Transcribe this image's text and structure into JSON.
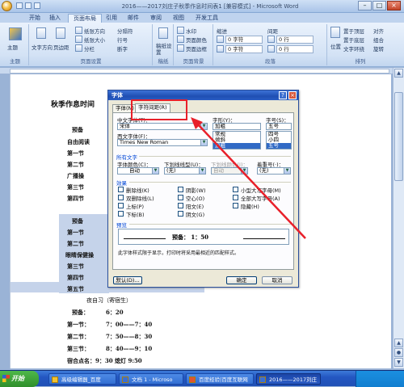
{
  "window": {
    "title": "2016——2017刘庄子秋季作息时间表1 [兼容模式] - Microsoft Word"
  },
  "ribbon_tabs": [
    {
      "label": "开始"
    },
    {
      "label": "插入"
    },
    {
      "label": "页面布局"
    },
    {
      "label": "引用"
    },
    {
      "label": "邮件"
    },
    {
      "label": "审阅"
    },
    {
      "label": "视图"
    },
    {
      "label": "开发工具"
    }
  ],
  "ribbon": {
    "groups": {
      "theme": "主题",
      "page_setup": "页面设置",
      "draft": "稿纸",
      "page_bg": "页面背景",
      "paragraph": "段落",
      "arrange": "排列"
    },
    "items": {
      "theme": "主题",
      "text_direction": "文字方向",
      "margins": "页边距",
      "size": "纸张大小",
      "orientation": "纸张方向",
      "columns": "分栏",
      "breaks": "分隔符",
      "line_numbers": "行号",
      "hyphenation": "断字",
      "draft_settings": "稿纸设置",
      "watermark": "水印",
      "page_color": "页面颜色",
      "page_border": "页面边框",
      "indent": "缩进",
      "spacing": "间距",
      "indent_left": "0 字符",
      "indent_right": "0 字符",
      "space_before": "0 行",
      "space_after": "0 行",
      "position": "位置",
      "bring_front": "置于顶层",
      "send_back": "置于底层",
      "text_wrap": "文字环绕",
      "align": "对齐",
      "group": "组合",
      "rotate": "旋转"
    }
  },
  "document": {
    "title": "秋季作息时间",
    "labels_top": [
      "预备",
      "自由阅读",
      "第一节",
      "第二节",
      "广播操",
      "第三节",
      "第四节"
    ],
    "labels_selected": [
      "预备",
      "第一节",
      "第二节",
      "眼睛保健操",
      "第三节",
      "第四节",
      "第五节"
    ],
    "subtitle": "夜自习（寄宿生）",
    "bottom_rows": [
      {
        "label": "预备：",
        "time": "6：20"
      },
      {
        "label": "第一节：",
        "time": "7：00——7：40"
      },
      {
        "label": "第二节：",
        "time": "7：50——8：30"
      },
      {
        "label": "第三节：",
        "time": "8：40——9：10"
      }
    ],
    "last_row": "宿合点名：9：30    熄灯 9:50"
  },
  "font_dialog": {
    "title": "字体",
    "tabs": [
      {
        "label": "字体(N)"
      },
      {
        "label": "字符间距(R)"
      }
    ],
    "chinese_font_label": "中文字体(T)：",
    "chinese_font_value": "宋体",
    "western_font_label": "西文字体(F)：",
    "western_font_value": "Times New Roman",
    "style_label": "字形(Y)：",
    "style_value": "加粗",
    "style_options": [
      "常规",
      "倾斜",
      "加粗"
    ],
    "size_label": "字号(S)：",
    "size_value": "五号",
    "size_options": [
      "四号",
      "小四",
      "五号"
    ],
    "all_text_header": "所有文字",
    "font_color_label": "字体颜色(C)：",
    "font_color_value": "自动",
    "underline_label": "下划线线型(U)：",
    "underline_value": "(无)",
    "underline_color_label": "下划线颜色(I)：",
    "underline_color_value": "自动",
    "emphasis_label": "着重号(·)：",
    "emphasis_value": "(无)",
    "effects_header": "效果",
    "effects": [
      [
        "删除线(K)",
        "阴影(W)",
        "小型大写字母(M)"
      ],
      [
        "双删除线(L)",
        "空心(O)",
        "全部大写字母(A)"
      ],
      [
        "上标(P)",
        "阳文(E)",
        "隐藏(H)"
      ],
      [
        "下标(B)",
        "阴文(G)",
        ""
      ]
    ],
    "preview_header": "预览",
    "preview_text": "预备：    1：50",
    "note": "此字体样式限于显示，打印时将采用最相近的匹配样式。",
    "default_button": "默认(D)...",
    "ok_button": "确定",
    "cancel_button": "取消"
  },
  "taskbar": {
    "start": "开始",
    "items": [
      {
        "label": "高级编辑器_百度"
      },
      {
        "label": "文档 1 - Microso"
      },
      {
        "label": "百度经验|百度互联网"
      },
      {
        "label": "2016——2017刘庄"
      }
    ]
  },
  "colors": {
    "highlight_box": "#e8202a",
    "arrow": "#e8202a",
    "selection": "#c5d3ea"
  }
}
